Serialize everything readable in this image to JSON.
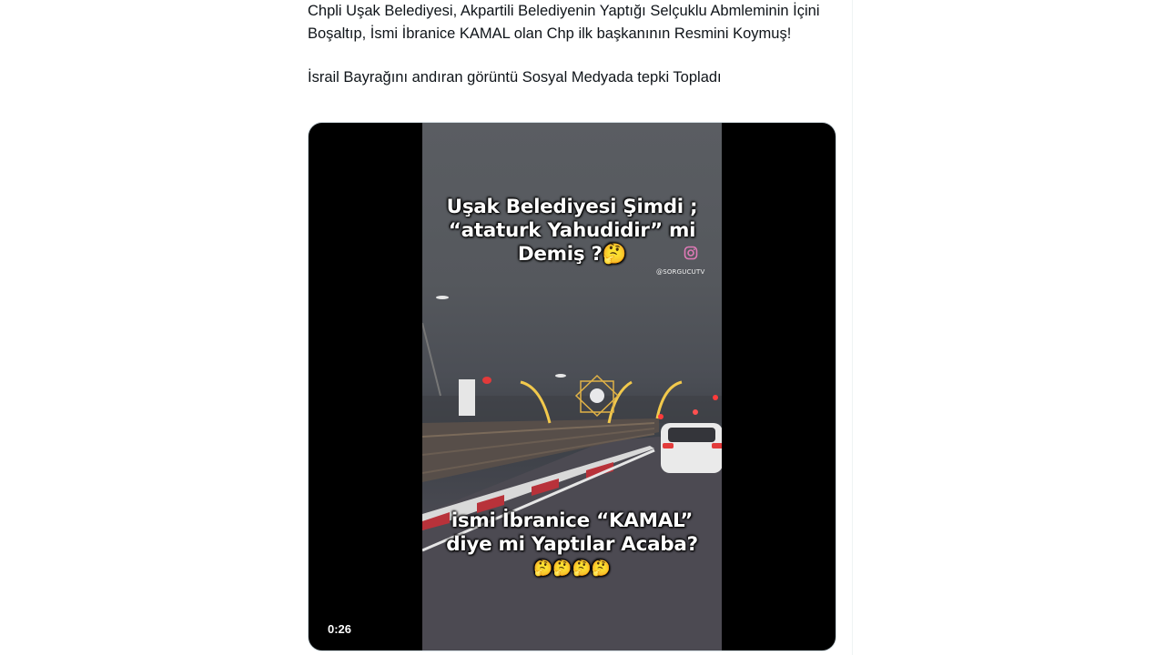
{
  "tweet": {
    "paragraph_1": "Chpli Uşak Belediyesi, Akpartili Belediyenin Yaptığı Selçuklu Abmleminin İçini Boşaltıp, İsmi İbranice KAMAL olan Chp ilk başkanının Resmini Koymuş!",
    "paragraph_2": "İsrail Bayrağını andıran görüntü Sosyal Medyada tepki Topladı"
  },
  "video": {
    "duration": "0:26",
    "overlay_top_line_1": "Uşak Belediyesi Şimdi ;",
    "overlay_top_line_2": "“ataturk Yahudidir” mi",
    "overlay_top_line_3": "Demiş ?🤔",
    "overlay_bottom_line_1": "ismi İbranice “KAMAL”",
    "overlay_bottom_line_2": "diye mi Yaptılar Acaba?",
    "overlay_bottom_emojis": "🤔🤔🤔🤔",
    "watermark": "@SORGUCUTV",
    "instagram_icon": "instagram-icon"
  }
}
